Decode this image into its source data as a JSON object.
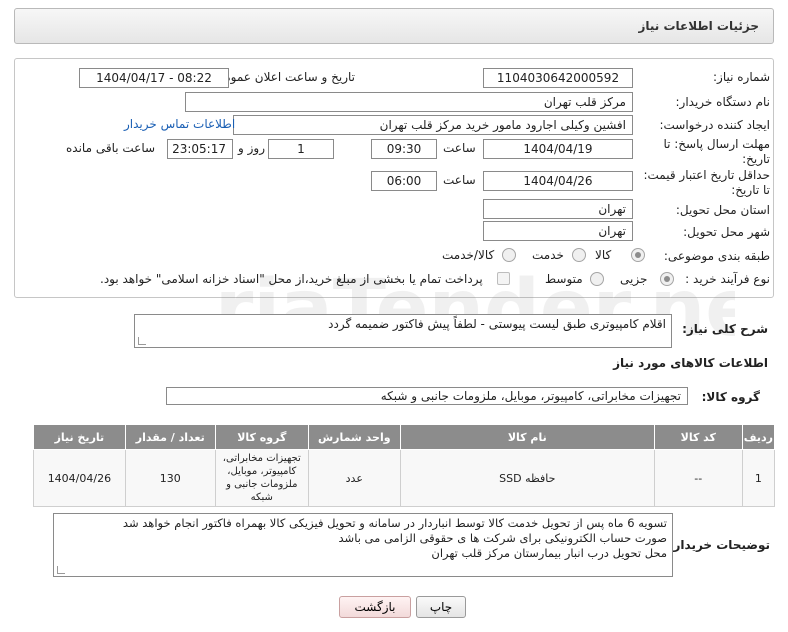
{
  "header": {
    "title": "جزئیات اطلاعات نیاز"
  },
  "fields": {
    "need_number_label": "شماره نیاز:",
    "need_number": "1104030642000592",
    "announce_label": "تاریخ و ساعت اعلان عمومی:",
    "announce_value": "1404/04/17 - 08:22",
    "buyer_org_label": "نام دستگاه خریدار:",
    "buyer_org": "مرکز قلب تهران",
    "creator_label": "ایجاد کننده درخواست:",
    "creator": "افشین وکیلی اجارود مامور خرید مرکز قلب تهران",
    "contact_link": "اطلاعات تماس خریدار",
    "deadline_label_line1": "مهلت ارسال پاسخ: تا",
    "deadline_label_line2": "تاریخ:",
    "deadline_date": "1404/04/19",
    "hour_label": "ساعت",
    "deadline_hour": "09:30",
    "days_value": "1",
    "days_label": "روز و",
    "remaining_time": "23:05:17",
    "remaining_label": "ساعت باقی مانده",
    "validity_label_line1": "حداقل تاریخ اعتبار قیمت:",
    "validity_label_line2": "تا تاریخ:",
    "validity_date": "1404/04/26",
    "validity_hour": "06:00",
    "province_label": "استان محل تحویل:",
    "province": "تهران",
    "city_label": "شهر محل تحویل:",
    "city": "تهران",
    "category_label": "طبقه بندی موضوعی:",
    "category_options": [
      "کالا",
      "خدمت",
      "کالا/خدمت"
    ],
    "process_label": "نوع فرآیند خرید :",
    "process_options": [
      "جزیی",
      "متوسط"
    ],
    "payment_note": "پرداخت تمام یا بخشی از مبلغ خرید،از محل \"اسناد خزانه اسلامی\" خواهد بود."
  },
  "description": {
    "label": "شرح کلی نیاز:",
    "value": "اقلام کامپیوتری طبق لیست پیوستی - لطفاً پیش فاکتور ضمیمه گردد"
  },
  "goods_info": {
    "title": "اطلاعات کالاهای مورد نیاز",
    "group_label": "گروه کالا:",
    "group_value": "تجهیزات مخابراتی، کامپیوتر، موبایل، ملزومات جانبی و شبکه"
  },
  "table": {
    "headers": [
      "ردیف",
      "کد کالا",
      "نام کالا",
      "واحد شمارش",
      "گروه کالا",
      "تعداد / مقدار",
      "تاریخ نیاز"
    ],
    "rows": [
      {
        "row": "1",
        "code": "--",
        "name": "حافظه SSD",
        "unit": "عدد",
        "group": "تجهیزات مخابراتی، کامپیوتر، موبایل، ملزومات جانبی و شبکه",
        "qty": "130",
        "date": "1404/04/26"
      }
    ]
  },
  "buyer_notes": {
    "label": "توضیحات خریدار:",
    "line1": "تسویه 6 ماه پس از تحویل خدمت کالا توسط انباردار در سامانه و تحویل فیزیکی کالا بهمراه فاکتور انجام خواهد شد",
    "line2": "صورت حساب الکترونیکی برای شرکت ها ی حقوقی الزامی می باشد",
    "line3": "محل تحویل درب انبار بیمارستان مرکز قلب تهران"
  },
  "buttons": {
    "print": "چاپ",
    "back": "بازگشت"
  },
  "watermark": "AriaTender.net"
}
